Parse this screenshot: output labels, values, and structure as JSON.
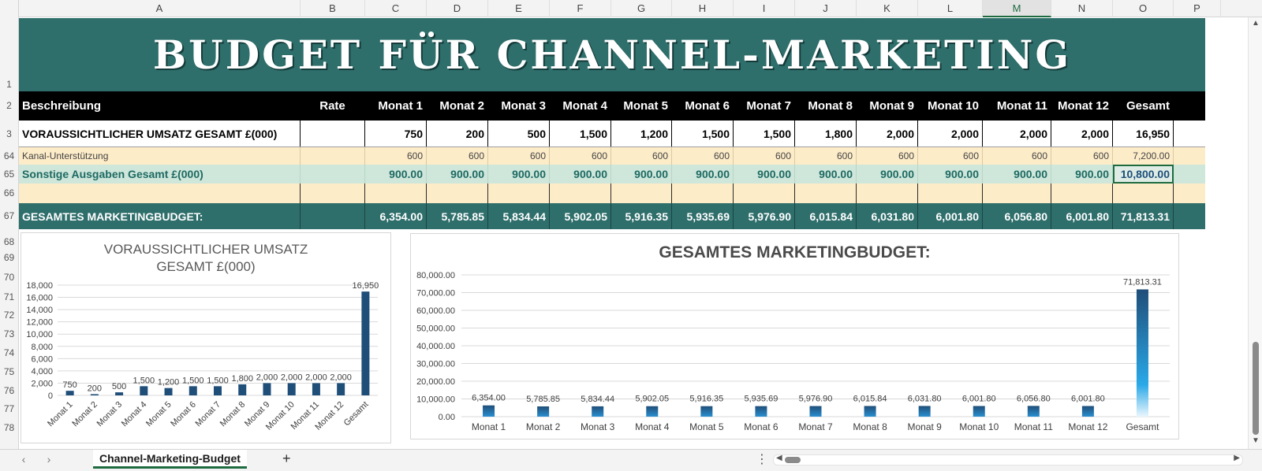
{
  "columns": [
    "A",
    "B",
    "C",
    "D",
    "E",
    "F",
    "G",
    "H",
    "I",
    "J",
    "K",
    "L",
    "M",
    "N",
    "O",
    "P"
  ],
  "active_column": "M",
  "row_numbers": [
    "1",
    "2",
    "3",
    "64",
    "65",
    "66",
    "67",
    "68",
    "69",
    "70",
    "71",
    "72",
    "73",
    "74",
    "75",
    "76",
    "77",
    "78"
  ],
  "title": "BUDGET FÜR CHANNEL-MARKETING",
  "header_row": {
    "description": "Beschreibung",
    "rate": "Rate",
    "months": [
      "Monat 1",
      "Monat 2",
      "Monat 3",
      "Monat 4",
      "Monat 5",
      "Monat 6",
      "Monat 7",
      "Monat 8",
      "Monat 9",
      "Monat 10",
      "Monat 11",
      "Monat 12"
    ],
    "total": "Gesamt"
  },
  "revenue_row": {
    "label": "VORAUSSICHTLICHER UMSATZ GESAMT £(000)",
    "rate": "",
    "values": [
      "750",
      "200",
      "500",
      "1,500",
      "1,200",
      "1,500",
      "1,500",
      "1,800",
      "2,000",
      "2,000",
      "2,000",
      "2,000"
    ],
    "total": "16,950"
  },
  "channel_row": {
    "label": "Kanal-Unterstützung",
    "rate": "",
    "values": [
      "600",
      "600",
      "600",
      "600",
      "600",
      "600",
      "600",
      "600",
      "600",
      "600",
      "600",
      "600"
    ],
    "total": "7,200.00"
  },
  "other_row": {
    "label": "Sonstige Ausgaben Gesamt £(000)",
    "rate": "",
    "values": [
      "900.00",
      "900.00",
      "900.00",
      "900.00",
      "900.00",
      "900.00",
      "900.00",
      "900.00",
      "900.00",
      "900.00",
      "900.00",
      "900.00"
    ],
    "total": "10,800.00"
  },
  "budget_row": {
    "label": "GESAMTES MARKETINGBUDGET:",
    "rate": "",
    "values": [
      "6,354.00",
      "5,785.85",
      "5,834.44",
      "5,902.05",
      "5,916.35",
      "5,935.69",
      "5,976.90",
      "6,015.84",
      "6,031.80",
      "6,001.80",
      "6,056.80",
      "6,001.80"
    ],
    "total": "71,813.31"
  },
  "chart_data": [
    {
      "type": "bar",
      "title": "VORAUSSICHTLICHER UMSATZ GESAMT £(000)",
      "categories": [
        "Monat 1",
        "Monat 2",
        "Monat 3",
        "Monat 4",
        "Monat 5",
        "Monat 6",
        "Monat 7",
        "Monat 8",
        "Monat 9",
        "Monat 10",
        "Monat 11",
        "Monat 12",
        "Gesamt"
      ],
      "values": [
        750,
        200,
        500,
        1500,
        1200,
        1500,
        1500,
        1800,
        2000,
        2000,
        2000,
        2000,
        16950
      ],
      "data_labels": [
        "750",
        "200",
        "500",
        "1,500",
        "1,200",
        "1,500",
        "1,500",
        "1,800",
        "2,000",
        "2,000",
        "2,000",
        "2,000",
        "16,950"
      ],
      "ylim": [
        0,
        18000
      ],
      "yticks": [
        "0",
        "2,000",
        "4,000",
        "6,000",
        "8,000",
        "10,000",
        "12,000",
        "14,000",
        "16,000",
        "18,000"
      ],
      "grid": true,
      "color": "#1f4e79"
    },
    {
      "type": "bar",
      "title": "GESAMTES MARKETINGBUDGET:",
      "categories": [
        "Monat 1",
        "Monat 2",
        "Monat 3",
        "Monat 4",
        "Monat 5",
        "Monat 6",
        "Monat 7",
        "Monat 8",
        "Monat 9",
        "Monat 10",
        "Monat 11",
        "Monat 12",
        "Gesamt"
      ],
      "values": [
        6354.0,
        5785.85,
        5834.44,
        5902.05,
        5916.35,
        5935.69,
        5976.9,
        6015.84,
        6031.8,
        6001.8,
        6056.8,
        6001.8,
        71813.31
      ],
      "data_labels": [
        "6,354.00",
        "5,785.85",
        "5,834.44",
        "5,902.05",
        "5,916.35",
        "5,935.69",
        "5,976.90",
        "6,015.84",
        "6,031.80",
        "6,001.80",
        "6,056.80",
        "6,001.80",
        "71,813.31"
      ],
      "ylim": [
        0,
        80000
      ],
      "yticks": [
        "0.00",
        "10,000.00",
        "20,000.00",
        "30,000.00",
        "40,000.00",
        "50,000.00",
        "60,000.00",
        "70,000.00",
        "80,000.00"
      ],
      "grid": true,
      "color": "#1f4e79",
      "gradient_to": "#2aa9e8"
    }
  ],
  "sheet_tab": "Channel-Marketing-Budget",
  "colors": {
    "teal": "#2e6e6b",
    "peach": "#fdecc8",
    "mint": "#cfe6da",
    "accent_green": "#1e6b40"
  }
}
